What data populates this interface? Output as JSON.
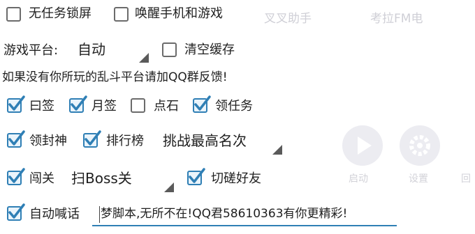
{
  "background": {
    "top_labels": [
      "叉叉助手",
      "考拉FM电"
    ],
    "bottom_labels": [
      "启动",
      "设置",
      "回"
    ]
  },
  "options": {
    "lock_screen": {
      "label": "无任务锁屏",
      "checked": false
    },
    "wake_phone": {
      "label": "唤醒手机和游戏",
      "checked": false
    },
    "clear_cache": {
      "label": "清空缓存",
      "checked": false
    }
  },
  "platform": {
    "label": "游戏平台:",
    "value": "自动"
  },
  "notice": "如果没有你所玩的乱斗平台请加QQ群反馈!",
  "tasks_row1": [
    {
      "label": "曰签",
      "checked": true
    },
    {
      "label": "月签",
      "checked": true
    },
    {
      "label": "点石",
      "checked": false
    },
    {
      "label": "领任务",
      "checked": true
    }
  ],
  "tasks_row2": [
    {
      "label": "领封神",
      "checked": true
    },
    {
      "label": "排行榜",
      "checked": true
    }
  ],
  "rank_mode": {
    "value": "挑战最高名次"
  },
  "tasks_row3": {
    "pass": {
      "label": "闯关",
      "checked": true
    },
    "spar": {
      "label": "切磋好友",
      "checked": true
    }
  },
  "pass_mode": {
    "value": "扫Boss关"
  },
  "auto_shout": {
    "label": "自动喊话",
    "checked": true,
    "message": "梦脚本,无所不在!QQ君58610363有你更精彩!"
  },
  "colors": {
    "accent": "#2f7fb5",
    "text": "#1f1f1f"
  }
}
